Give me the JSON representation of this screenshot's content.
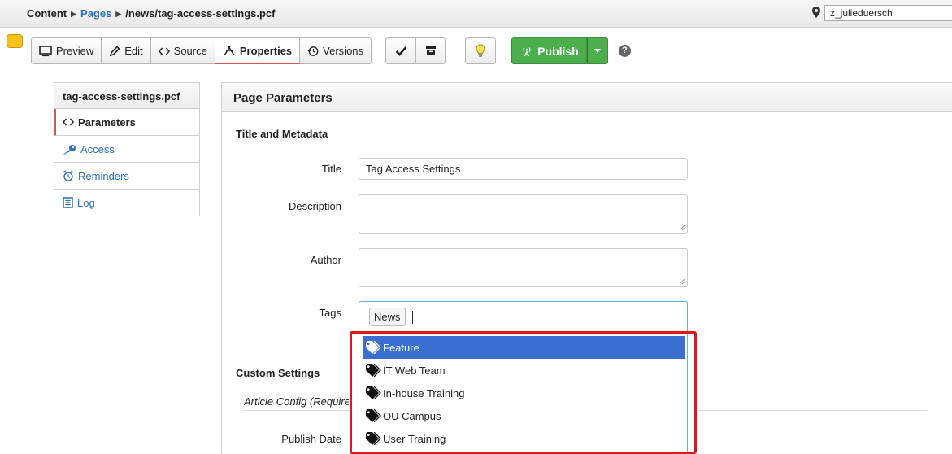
{
  "breadcrumb": {
    "root": "Content",
    "pages": "Pages",
    "path": "/news/tag-access-settings.pcf"
  },
  "user": {
    "name": "z_julieduersch"
  },
  "toolbar": {
    "preview": "Preview",
    "edit": "Edit",
    "source": "Source",
    "properties": "Properties",
    "versions": "Versions",
    "publish": "Publish"
  },
  "sidebar": {
    "title": "tag-access-settings.pcf",
    "items": [
      {
        "label": "Parameters",
        "icon": "code-icon"
      },
      {
        "label": "Access",
        "icon": "key-icon"
      },
      {
        "label": "Reminders",
        "icon": "alarm-clock-icon"
      },
      {
        "label": "Log",
        "icon": "log-icon"
      }
    ]
  },
  "panel": {
    "title": "Page Parameters",
    "section_title_meta": "Title and Metadata",
    "fields": {
      "title_label": "Title",
      "title_value": "Tag Access Settings",
      "description_label": "Description",
      "author_label": "Author",
      "tags_label": "Tags",
      "publish_date_label": "Publish Date"
    },
    "tags": {
      "selected": [
        "News"
      ],
      "options": [
        "Feature",
        "IT Web Team",
        "In-house Training",
        "OU Campus",
        "User Training"
      ]
    },
    "custom_settings": "Custom Settings",
    "article_config": "Article Config (Require"
  },
  "colors": {
    "link": "#2a6ebb",
    "publish_green": "#4cae4c",
    "selected_option": "#3a6fcf",
    "highlight_red": "#e0161b",
    "active_tab_marker": "#d9534f"
  }
}
